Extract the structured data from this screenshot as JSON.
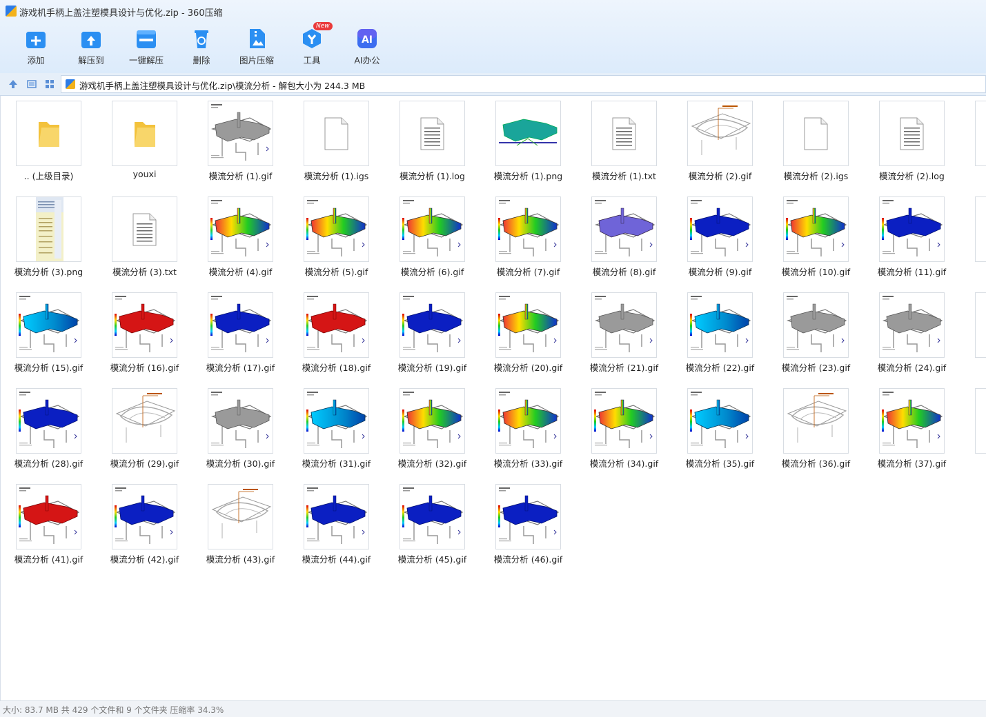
{
  "window": {
    "title": "游戏机手柄上盖注塑模具设计与优化.zip - 360压缩"
  },
  "toolbar": [
    {
      "label": "添加",
      "icon": "add-icon",
      "color": "#2b8ff2"
    },
    {
      "label": "解压到",
      "icon": "extract-to-icon",
      "color": "#2b8ff2"
    },
    {
      "label": "一键解压",
      "icon": "one-click-extract-icon",
      "color": "#2b8ff2"
    },
    {
      "label": "删除",
      "icon": "delete-icon",
      "color": "#2b8ff2"
    },
    {
      "label": "图片压缩",
      "icon": "image-compress-icon",
      "color": "#2b8ff2"
    },
    {
      "label": "工具",
      "icon": "tools-icon",
      "color": "#2b8ff2",
      "badge": "New"
    },
    {
      "label": "AI办公",
      "icon": "ai-office-icon",
      "color": "#3c6df0"
    }
  ],
  "navbar": {
    "up_icon": "up-arrow-icon",
    "view_icon": "details-view-icon",
    "grid_icon": "thumbnail-view-icon",
    "path": "游戏机手柄上盖注塑模具设计与优化.zip\\模流分析 - 解包大小为 244.3 MB"
  },
  "files": [
    [
      {
        "name": ".. (上级目录)",
        "kind": "folder"
      },
      {
        "name": "youxi",
        "kind": "folder"
      },
      {
        "name": "模流分析 (1).gif",
        "kind": "gray"
      },
      {
        "name": "模流分析 (1).igs",
        "kind": "blank"
      },
      {
        "name": "模流分析 (1).log",
        "kind": "text"
      },
      {
        "name": "模流分析 (1).png",
        "kind": "teal"
      },
      {
        "name": "模流分析 (1).txt",
        "kind": "text"
      },
      {
        "name": "模流分析 (2).gif",
        "kind": "wire"
      },
      {
        "name": "模流分析 (2).igs",
        "kind": "blank"
      },
      {
        "name": "模流分析 (2).log",
        "kind": "text"
      },
      {
        "name": "模流",
        "kind": "partial"
      }
    ],
    [
      {
        "name": "模流分析 (3).png",
        "kind": "shot"
      },
      {
        "name": "模流分析 (3).txt",
        "kind": "text"
      },
      {
        "name": "模流分析 (4).gif",
        "kind": "rainbow"
      },
      {
        "name": "模流分析 (5).gif",
        "kind": "rainbow"
      },
      {
        "name": "模流分析 (6).gif",
        "kind": "rainbow"
      },
      {
        "name": "模流分析 (7).gif",
        "kind": "rainbow"
      },
      {
        "name": "模流分析 (8).gif",
        "kind": "purple"
      },
      {
        "name": "模流分析 (9).gif",
        "kind": "blue"
      },
      {
        "name": "模流分析 (10).gif",
        "kind": "rainbow"
      },
      {
        "name": "模流分析 (11).gif",
        "kind": "blue"
      },
      {
        "name": "模流",
        "kind": "partial"
      }
    ],
    [
      {
        "name": "模流分析 (15).gif",
        "kind": "cyan"
      },
      {
        "name": "模流分析 (16).gif",
        "kind": "red"
      },
      {
        "name": "模流分析 (17).gif",
        "kind": "blue"
      },
      {
        "name": "模流分析 (18).gif",
        "kind": "red"
      },
      {
        "name": "模流分析 (19).gif",
        "kind": "blue"
      },
      {
        "name": "模流分析 (20).gif",
        "kind": "rainbow"
      },
      {
        "name": "模流分析 (21).gif",
        "kind": "gray"
      },
      {
        "name": "模流分析 (22).gif",
        "kind": "cyan"
      },
      {
        "name": "模流分析 (23).gif",
        "kind": "gray"
      },
      {
        "name": "模流分析 (24).gif",
        "kind": "gray"
      },
      {
        "name": "模流",
        "kind": "partial"
      }
    ],
    [
      {
        "name": "模流分析 (28).gif",
        "kind": "blue"
      },
      {
        "name": "模流分析 (29).gif",
        "kind": "wire"
      },
      {
        "name": "模流分析 (30).gif",
        "kind": "gray"
      },
      {
        "name": "模流分析 (31).gif",
        "kind": "cyan"
      },
      {
        "name": "模流分析 (32).gif",
        "kind": "rainbow"
      },
      {
        "name": "模流分析 (33).gif",
        "kind": "rainbow"
      },
      {
        "name": "模流分析 (34).gif",
        "kind": "rainbow"
      },
      {
        "name": "模流分析 (35).gif",
        "kind": "cyan"
      },
      {
        "name": "模流分析 (36).gif",
        "kind": "wire"
      },
      {
        "name": "模流分析 (37).gif",
        "kind": "rainbow"
      },
      {
        "name": "模流",
        "kind": "partial"
      }
    ],
    [
      {
        "name": "模流分析 (41).gif",
        "kind": "red"
      },
      {
        "name": "模流分析 (42).gif",
        "kind": "blue"
      },
      {
        "name": "模流分析 (43).gif",
        "kind": "wire"
      },
      {
        "name": "模流分析 (44).gif",
        "kind": "blue"
      },
      {
        "name": "模流分析 (45).gif",
        "kind": "blue"
      },
      {
        "name": "模流分析 (46).gif",
        "kind": "blue"
      }
    ]
  ],
  "status": {
    "text": "大小: 83.7 MB 共 429 个文件和 9 个文件夹 压缩率 34.3%"
  }
}
